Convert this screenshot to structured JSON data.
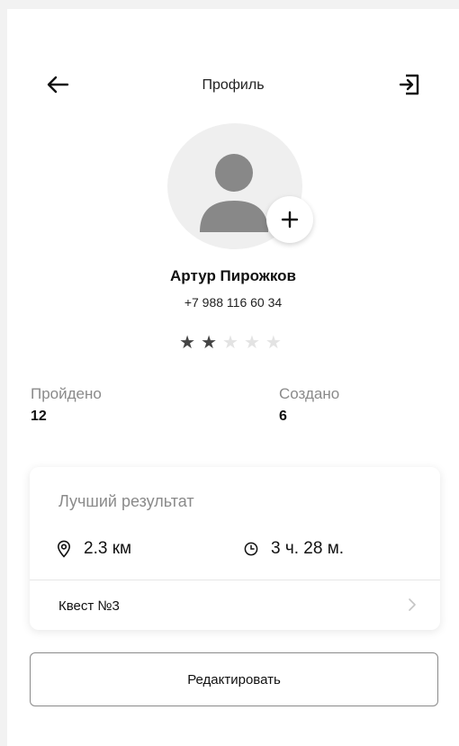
{
  "header": {
    "title": "Профиль",
    "back_icon": "arrow-left-icon",
    "logout_icon": "logout-icon"
  },
  "profile": {
    "avatar_icon": "user-placeholder-icon",
    "add_photo_icon": "plus-icon",
    "name": "Артур Пирожков",
    "phone": "+7 988 116 60 34",
    "rating": 2,
    "rating_max": 5
  },
  "stats": {
    "completed_label": "Пройдено",
    "completed_value": "12",
    "created_label": "Создано",
    "created_value": "6"
  },
  "best_result": {
    "title": "Лучший результат",
    "distance": "2.3 км",
    "distance_icon": "location-pin-icon",
    "time": "3 ч. 28 м.",
    "time_icon": "clock-icon",
    "quest_name": "Квест №3",
    "quest_icon": "chevron-right-icon"
  },
  "actions": {
    "edit_label": "Редактировать"
  },
  "colors": {
    "background": "#ffffff",
    "muted_text": "#8a8a8a",
    "star_on": "#444444",
    "star_off": "#e3e3e3"
  }
}
